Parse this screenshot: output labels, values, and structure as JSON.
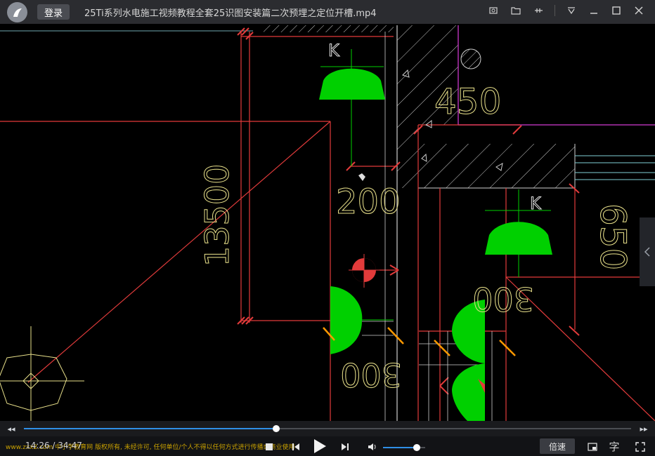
{
  "titlebar": {
    "login_label": "登录",
    "title": "25Ti系列水电施工视频教程全套25识图安装篇二次预埋之定位开槽.mp4",
    "icons": [
      "screenshot-icon",
      "folder-icon",
      "pin-icon",
      "menu-icon",
      "minimize-icon",
      "maximize-icon",
      "close-icon"
    ]
  },
  "drawing": {
    "dim_450": "450",
    "dim_200": "200",
    "dim_13500": "13500",
    "dim_650": "650",
    "dim_300_right": "300",
    "dim_300_left": "300",
    "marker_k1": "K",
    "marker_k2": "K"
  },
  "player": {
    "progress": 0.4155,
    "current_time": "14:26",
    "total_time": "34:47",
    "time_text": "14:26 / 34:47",
    "volume": 0.8,
    "speed_label": "倍速",
    "subtitle_label": "字",
    "watermark": "www.zxx2.com 中小学教育网 版权所有, 未经许可, 任何单位/个人不得以任何方式进行传播或商业使用"
  },
  "colors": {
    "accent": "#2f8fe6",
    "cad_red": "#e23b3b",
    "cad_green": "#00d000",
    "cad_yellow": "#e8e08a",
    "cad_cyan": "#7fd0d6",
    "cad_orange": "#ff9900"
  }
}
